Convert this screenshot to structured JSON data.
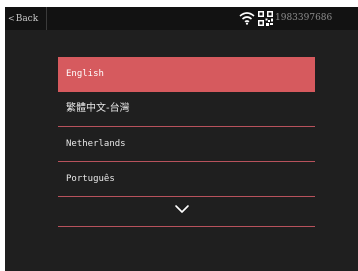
{
  "header": {
    "back_label": "Back",
    "back_icon": "chevron-left-icon",
    "wifi_icon": "wifi-icon",
    "qr_icon": "qr-code-icon",
    "serial": "1983397686"
  },
  "languages": {
    "items": [
      {
        "label": "English",
        "selected": true
      },
      {
        "label": "繁體中文-台灣",
        "selected": false
      },
      {
        "label": "Netherlands",
        "selected": false
      },
      {
        "label": "Português",
        "selected": false
      }
    ],
    "more_icon": "chevron-down-icon"
  },
  "colors": {
    "accent": "#d65a5e",
    "divider": "#b8525c",
    "background": "#1f1f1f",
    "topbar": "#121212"
  }
}
